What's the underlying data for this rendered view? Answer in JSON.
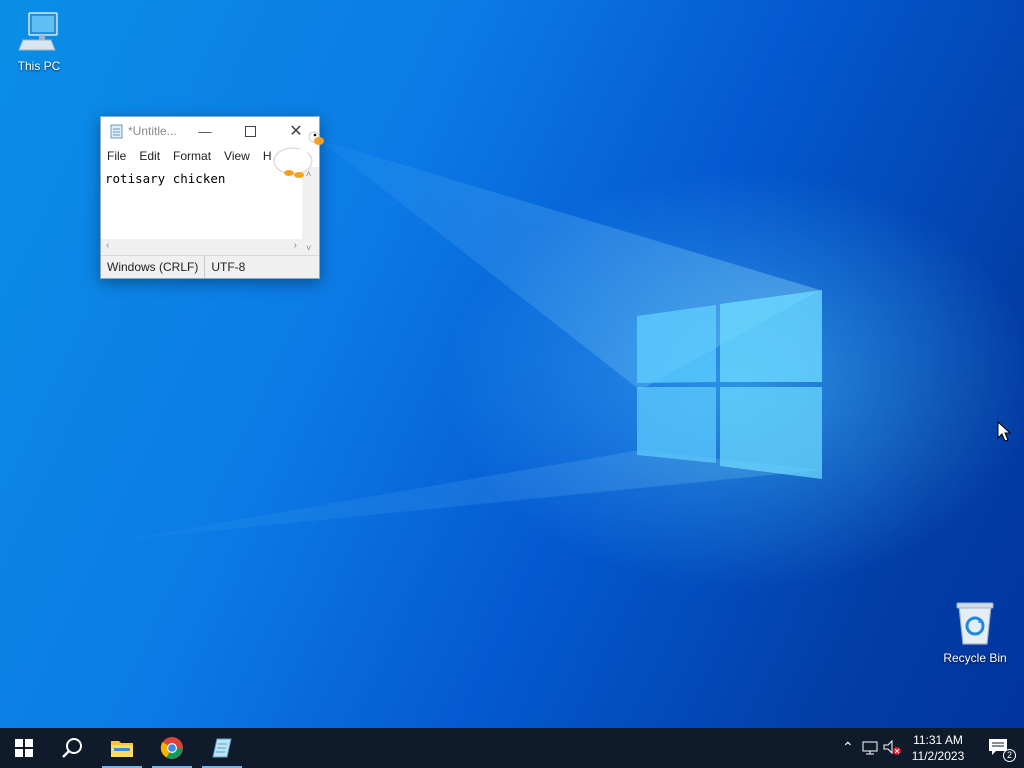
{
  "desktop": {
    "icons": [
      {
        "label": "This PC",
        "icon": "computer-icon"
      },
      {
        "label": "Recycle Bin",
        "icon": "recycle-bin-icon"
      }
    ]
  },
  "notepad": {
    "title": "*Untitle...",
    "menu": [
      "File",
      "Edit",
      "Format",
      "View",
      "H"
    ],
    "content": "rotisary chicken",
    "status": {
      "line_ending": "Windows (CRLF)",
      "encoding": "UTF-8"
    }
  },
  "taskbar": {
    "apps": [
      "start-icon",
      "search-icon",
      "file-explorer-icon",
      "chrome-icon",
      "notepad-icon"
    ],
    "tray": {
      "time": "11:31 AM",
      "date": "11/2/2023",
      "notifications": "2"
    }
  },
  "colors": {
    "taskbar": "#0f1b2b",
    "desktop_accent": "#0a8fe6"
  }
}
